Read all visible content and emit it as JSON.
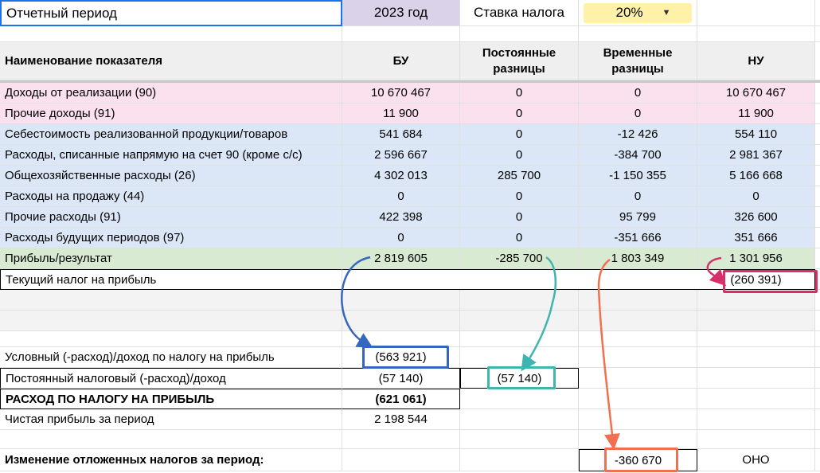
{
  "period": {
    "label": "Отчетный период",
    "value": "2023 год",
    "rate_label": "Ставка налога",
    "rate_value": "20%"
  },
  "columns": [
    "Наименование показателя",
    "БУ",
    "Постоянные разницы",
    "Временные разницы",
    "НУ"
  ],
  "rows": [
    {
      "name": "Доходы от реализации (90)",
      "bu": "10 670 467",
      "pr": "0",
      "vr": "0",
      "nu": "10 670 467",
      "color": "#fbe0ee"
    },
    {
      "name": "Прочие доходы (91)",
      "bu": "11 900",
      "pr": "0",
      "vr": "0",
      "nu": "11 900",
      "color": "#fbe0ee"
    },
    {
      "name": "Себестоимость реализованной продукции/товаров",
      "bu": "541 684",
      "pr": "0",
      "vr": "-12 426",
      "nu": "554 110",
      "color": "#dbe7f6"
    },
    {
      "name": "Расходы, списанные напрямую на счет 90 (кроме с/с)",
      "bu": "2 596 667",
      "pr": "0",
      "vr": "-384 700",
      "nu": "2 981 367",
      "color": "#dbe7f6"
    },
    {
      "name": "Общехозяйственные расходы (26)",
      "bu": "4 302 013",
      "pr": "285 700",
      "vr": "-1 150 355",
      "nu": "5 166 668",
      "color": "#dbe7f6"
    },
    {
      "name": "Расходы на продажу (44)",
      "bu": "0",
      "pr": "0",
      "vr": "0",
      "nu": "0",
      "color": "#dbe7f6"
    },
    {
      "name": "Прочие расходы (91)",
      "bu": "422 398",
      "pr": "0",
      "vr": "95 799",
      "nu": "326 600",
      "color": "#dbe7f6"
    },
    {
      "name": "Расходы будущих периодов (97)",
      "bu": "0",
      "pr": "0",
      "vr": "-351 666",
      "nu": "351 666",
      "color": "#dbe7f6"
    },
    {
      "name": "Прибыль/результат",
      "bu": "2 819 605",
      "pr": "-285 700",
      "vr": "1 803 349",
      "nu": "1 301 956",
      "color": "#d9ead3"
    }
  ],
  "current_tax": {
    "label": "Текущий налог на прибыль",
    "nu": "(260 391)"
  },
  "conditional": {
    "label": "Условный (-расход)/доход по налогу на прибыль",
    "bu": "(563 921)"
  },
  "permanent": {
    "label": "Постоянный налоговый (-расход)/доход",
    "bu": "(57 140)",
    "pr": "(57 140)"
  },
  "expense": {
    "label": "РАСХОД ПО НАЛОГУ НА ПРИБЫЛЬ",
    "bu": "(621 061)"
  },
  "net": {
    "label": "Чистая прибыль за период",
    "bu": "2 198 544"
  },
  "deferred": {
    "label": "Изменение отложенных налогов за период:",
    "vr": "-360 670",
    "nu": "ОНО"
  },
  "colors": {
    "pink": "#fbe0ee",
    "blue": "#dbe7f6",
    "green": "#d9ead3",
    "lavender": "#d9d2e9",
    "yellow": "#fff2a8",
    "arrow_blue": "#3367c2",
    "arrow_teal": "#3fb5b0",
    "arrow_orange": "#f36f4f",
    "arrow_magenta": "#d6306a"
  }
}
